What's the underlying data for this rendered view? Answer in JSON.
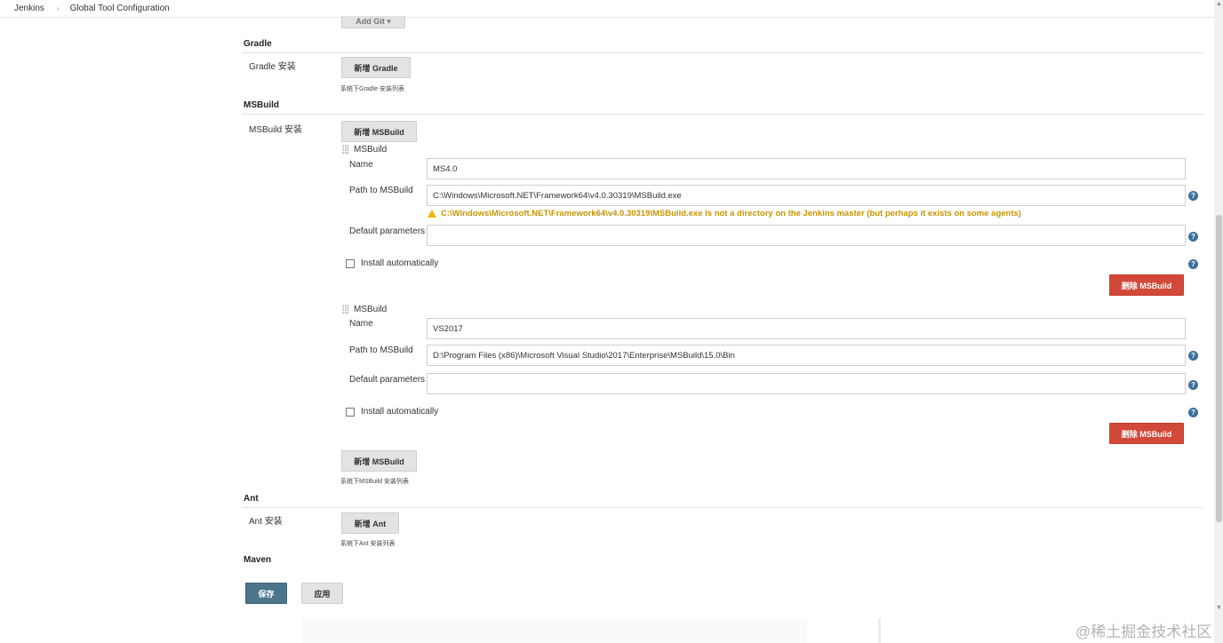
{
  "breadcrumb": {
    "root": "Jenkins",
    "current": "Global Tool Configuration",
    "separator": "›"
  },
  "partial_top_button": "Add Git ▾",
  "gradle": {
    "title": "Gradle",
    "row_label": "Gradle 安装",
    "add_button": "新增 Gradle",
    "hint": "系统下Gradle 安装列表"
  },
  "msbuild": {
    "title": "MSBuild",
    "row_label": "MSBuild 安装",
    "add_button_top": "新增 MSBuild",
    "add_button_bottom": "新增 MSBuild",
    "hint": "系统下MSBuild 安装列表",
    "field_labels": {
      "name": "Name",
      "path": "Path to MSBuild",
      "params": "Default parameters",
      "install": "Install automatically"
    },
    "installations": [
      {
        "header": "MSBuild",
        "name": "MS4.0",
        "path": "C:\\Windows\\Microsoft.NET\\Framework64\\v4.0.30319\\MSBuild.exe",
        "warning": "C:\\Windows\\Microsoft.NET\\Framework64\\v4.0.30319\\MSBuild.exe is not a directory on the Jenkins master (but perhaps it exists on some agents)",
        "params": "",
        "delete_button": "删除 MSBuild"
      },
      {
        "header": "MSBuild",
        "name": "VS2017",
        "path": "D:\\Program Files (x86)\\Microsoft Visual Studio\\2017\\Enterprise\\MSBuild\\15.0\\Bin",
        "warning": "",
        "params": "",
        "delete_button": "删除 MSBuild"
      }
    ]
  },
  "ant": {
    "title": "Ant",
    "row_label": "Ant 安装",
    "add_button": "新增 Ant",
    "hint": "系统下Ant 安装列表"
  },
  "maven": {
    "title": "Maven"
  },
  "footer": {
    "save": "保存",
    "apply": "应用"
  },
  "help_glyph": "?",
  "watermark": "@稀土掘金技术社区",
  "icons": [
    "grip-icon",
    "warning-icon",
    "help-icon",
    "checkbox-icon"
  ],
  "colors": {
    "delete": "#d24939",
    "save": "#4b758b",
    "warning": "#c69500",
    "help": "#3d6f9d"
  }
}
